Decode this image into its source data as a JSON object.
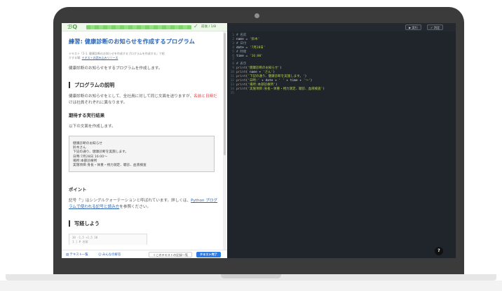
{
  "header": {
    "logo": "ℬQ",
    "step": "前後 / 1/8"
  },
  "left": {
    "title": "練習: 健康診断のお知らせを作成するプログラム",
    "meta_line1": "テキスト「2-1. 健康診断のお知らせを作成するプログラムを作成する」で紹",
    "meta_line2_label": "介する場:",
    "meta_line2_link": "テキストの読み込みリソース",
    "intro": "健康診断のお知らせをするプログラムを作成します。",
    "h_program": "プログラムの説明",
    "program_text_1": "健康診断のお知らせをとして、全社員に対して同じ文面を送りますが、",
    "program_text_accent": "名前と日時だ",
    "program_text_2": "けは社員それぞれに異なります。",
    "h_expected": "期待する実行結果",
    "expected_intro": "以下の文面を作成します。",
    "output_lines": [
      "健康診断のお知らせ",
      "鈴木さん",
      "下記の通り、健康診断を実施します。",
      "日時:7月28日 16:00〜",
      "場所:本部診療所",
      "実施項目:身長・体重・視力測定、聴診、血液検査"
    ],
    "h_point": "ポイント",
    "point_text_1": "記号「'」はシングルクォーテーションと呼ばれています。詳しくは、",
    "point_link": "Python プログ",
    "point_link_2": "ラムで使われる記号と読み方",
    "point_text_2": "を参照ください。",
    "h_step": "写経しよう",
    "code_line_1": "  38 -1,5 +1,5 38",
    "code_line_2": "   1  | # 名前"
  },
  "footer": {
    "list_link": "テキスト一覧",
    "ranking_link": "みんなの解答",
    "tasks_button": "＋このテキストの記録一覧",
    "finish_button": "テキスト完了"
  },
  "editor": {
    "run_button": "▶ 実行",
    "submit_button": "✓ 判定",
    "lines": [
      {
        "n": "1",
        "parts": [
          {
            "t": "# 名前",
            "c": "c-comment"
          }
        ]
      },
      {
        "n": "2",
        "parts": [
          {
            "t": "name = ",
            "c": "c-var"
          },
          {
            "t": "'鈴木'",
            "c": "c-str"
          }
        ]
      },
      {
        "n": "3",
        "parts": [
          {
            "t": "# 日付",
            "c": "c-comment"
          }
        ]
      },
      {
        "n": "4",
        "parts": [
          {
            "t": "date = ",
            "c": "c-var"
          },
          {
            "t": "'7月28日'",
            "c": "c-str"
          }
        ]
      },
      {
        "n": "5",
        "parts": [
          {
            "t": "# 時間",
            "c": "c-comment"
          }
        ]
      },
      {
        "n": "6",
        "parts": [
          {
            "t": "time = ",
            "c": "c-var"
          },
          {
            "t": "'16:00'",
            "c": "c-str"
          }
        ]
      },
      {
        "n": "7",
        "parts": []
      },
      {
        "n": "8",
        "parts": [
          {
            "t": "# 表示",
            "c": "c-comment"
          }
        ]
      },
      {
        "n": "9",
        "parts": [
          {
            "t": "print",
            "c": "c-fn"
          },
          {
            "t": "(",
            "c": "c-var"
          },
          {
            "t": "'健康診断のお知らせ'",
            "c": "c-str"
          },
          {
            "t": ")",
            "c": "c-var"
          }
        ]
      },
      {
        "n": "10",
        "parts": [
          {
            "t": "print",
            "c": "c-fn"
          },
          {
            "t": "( name + ",
            "c": "c-var"
          },
          {
            "t": "'さん'",
            "c": "c-str"
          },
          {
            "t": ")",
            "c": "c-var"
          }
        ]
      },
      {
        "n": "11",
        "parts": [
          {
            "t": "print",
            "c": "c-fn"
          },
          {
            "t": "(",
            "c": "c-var"
          },
          {
            "t": "'下記の通り、健康診断を実施します。'",
            "c": "c-str"
          },
          {
            "t": ")",
            "c": "c-var"
          }
        ]
      },
      {
        "n": "12",
        "parts": [
          {
            "t": "print",
            "c": "c-fn"
          },
          {
            "t": "(",
            "c": "c-var"
          },
          {
            "t": "'日時:'",
            "c": "c-str"
          },
          {
            "t": " + date + ",
            "c": "c-var"
          },
          {
            "t": "' '",
            "c": "c-str"
          },
          {
            "t": " + time + ",
            "c": "c-var"
          },
          {
            "t": "'〜'",
            "c": "c-str"
          },
          {
            "t": ")",
            "c": "c-var"
          }
        ]
      },
      {
        "n": "13",
        "parts": [
          {
            "t": "print",
            "c": "c-fn"
          },
          {
            "t": "(",
            "c": "c-var"
          },
          {
            "t": "'場所:本部診療所'",
            "c": "c-str"
          },
          {
            "t": ")",
            "c": "c-var"
          }
        ]
      },
      {
        "n": "14",
        "parts": [
          {
            "t": "print",
            "c": "c-fn"
          },
          {
            "t": "(",
            "c": "c-var"
          },
          {
            "t": "'実施項目:身長・体重・視力測定、聴診、血液検査'",
            "c": "c-str"
          },
          {
            "t": ")",
            "c": "c-var"
          }
        ]
      },
      {
        "n": "15",
        "parts": []
      }
    ]
  },
  "help": "?"
}
